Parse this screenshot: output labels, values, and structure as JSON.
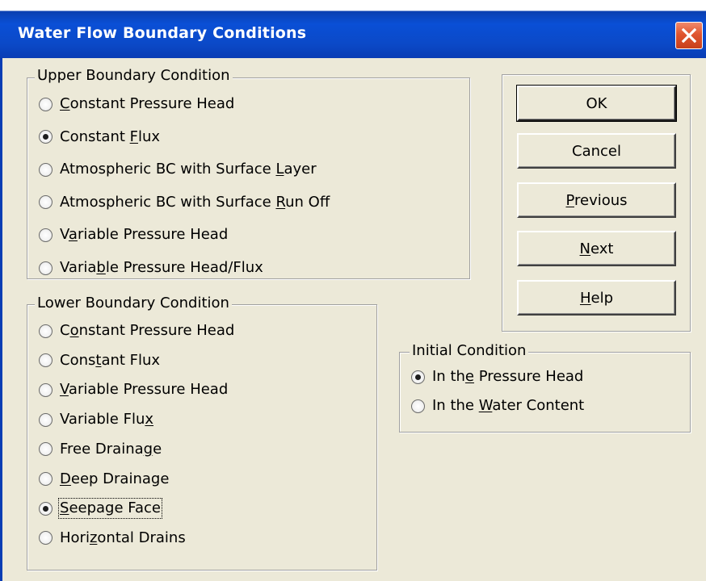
{
  "window": {
    "title": "Water Flow Boundary Conditions",
    "close_icon": "close-icon"
  },
  "upper": {
    "legend": "Upper Boundary Condition",
    "options": [
      {
        "pre": "",
        "key": "C",
        "post": "onstant Pressure Head",
        "checked": false
      },
      {
        "pre": "Constant ",
        "key": "F",
        "post": "lux",
        "checked": true
      },
      {
        "pre": "Atmospheric BC with Surface ",
        "key": "L",
        "post": "ayer",
        "checked": false
      },
      {
        "pre": "Atmospheric BC with Surface ",
        "key": "R",
        "post": "un Off",
        "checked": false
      },
      {
        "pre": "V",
        "key": "a",
        "post": "riable Pressure Head",
        "checked": false
      },
      {
        "pre": "Varia",
        "key": "b",
        "post": "le Pressure Head/Flux",
        "checked": false
      }
    ]
  },
  "lower": {
    "legend": "Lower Boundary Condition",
    "options": [
      {
        "pre": "C",
        "key": "o",
        "post": "nstant Pressure Head",
        "checked": false
      },
      {
        "pre": "Cons",
        "key": "t",
        "post": "ant Flux",
        "checked": false
      },
      {
        "pre": "",
        "key": "V",
        "post": "ariable Pressure Head",
        "checked": false
      },
      {
        "pre": "Variable Flu",
        "key": "x",
        "post": "",
        "checked": false
      },
      {
        "pre": "Free Draina",
        "key": "g",
        "post": "e",
        "checked": false
      },
      {
        "pre": "",
        "key": "D",
        "post": "eep Drainage",
        "checked": false
      },
      {
        "pre": "",
        "key": "S",
        "post": "eepage Face",
        "checked": true
      },
      {
        "pre": "Hori",
        "key": "z",
        "post": "ontal Drains",
        "checked": false
      }
    ]
  },
  "initial": {
    "legend": "Initial Condition",
    "options": [
      {
        "pre": "In th",
        "key": "e",
        "post": " Pressure Head",
        "checked": true
      },
      {
        "pre": "In the ",
        "key": "W",
        "post": "ater Content",
        "checked": false
      }
    ]
  },
  "buttons": [
    {
      "pre": "OK",
      "key": "",
      "post": ""
    },
    {
      "pre": "Cancel",
      "key": "",
      "post": ""
    },
    {
      "pre": "",
      "key": "P",
      "post": "revious"
    },
    {
      "pre": "",
      "key": "N",
      "post": "ext"
    },
    {
      "pre": "",
      "key": "H",
      "post": "elp"
    }
  ]
}
